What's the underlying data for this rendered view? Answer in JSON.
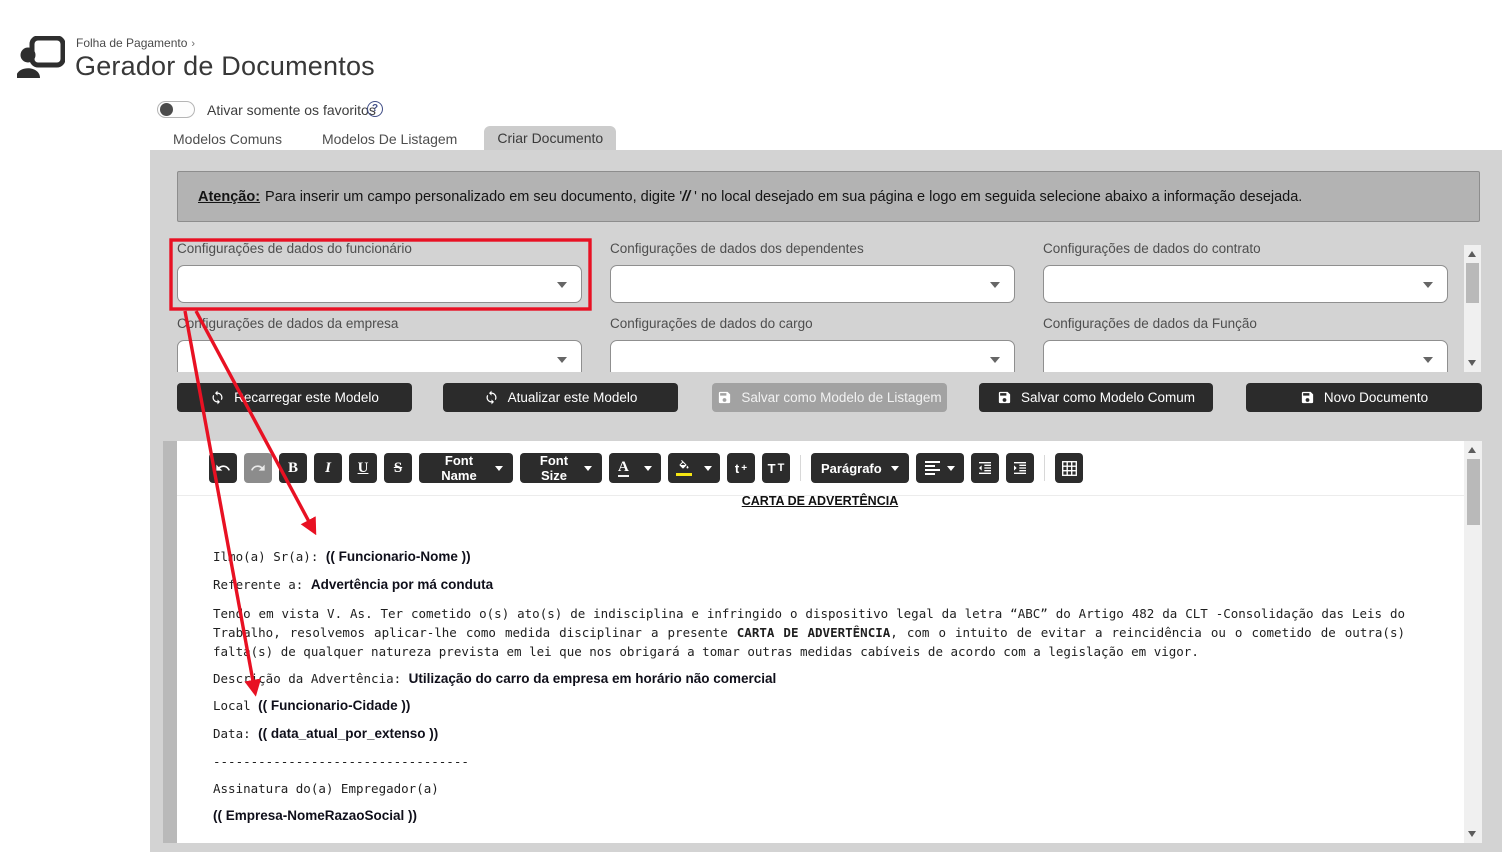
{
  "header": {
    "breadcrumb": "Folha de Pagamento",
    "breadcrumb_caret": "›",
    "title": "Gerador de Documentos"
  },
  "favorites": {
    "label": "Ativar somente os favoritos",
    "help_glyph": "?",
    "enabled": false
  },
  "tabs": [
    {
      "label": "Modelos Comuns",
      "active": false
    },
    {
      "label": "Modelos De Listagem",
      "active": false
    },
    {
      "label": "Criar Documento",
      "active": true
    }
  ],
  "notice": {
    "strong": "Atenção:",
    "pre": "Para inserir um campo personalizado em seu documento, digite '",
    "slashes": "//",
    "post": " ' no local desejado em sua página e logo em seguida selecione abaixo a informação desejada."
  },
  "fields": [
    {
      "label": "Configurações de dados do funcionário",
      "value": "",
      "highlighted": true
    },
    {
      "label": "Configurações de dados dos dependentes",
      "value": "",
      "highlighted": false
    },
    {
      "label": "Configurações de dados do contrato",
      "value": "",
      "highlighted": false
    },
    {
      "label": "Configurações de dados da empresa",
      "value": "",
      "highlighted": false
    },
    {
      "label": "Configurações de dados do cargo",
      "value": "",
      "highlighted": false
    },
    {
      "label": "Configurações de dados da Função",
      "value": "",
      "highlighted": false
    }
  ],
  "actions": [
    {
      "label": "Recarregar este Modelo",
      "icon": "refresh-icon",
      "disabled": false
    },
    {
      "label": "Atualizar este Modelo",
      "icon": "refresh-icon",
      "disabled": false
    },
    {
      "label": "Salvar como Modelo de Listagem",
      "icon": "save-icon",
      "disabled": true
    },
    {
      "label": "Salvar como Modelo Comum",
      "icon": "save-icon",
      "disabled": false
    },
    {
      "label": "Novo Documento",
      "icon": "save-icon",
      "disabled": false
    }
  ],
  "toolbar": {
    "bold": "B",
    "italic": "I",
    "underline": "U",
    "strike": "S",
    "font_name": "Font Name",
    "font_size": "Font Size",
    "font_color": "A",
    "sub_main": "t",
    "sub_plus": "+",
    "case_main": "T",
    "case_small": "T",
    "paragraph": "Parágrafo"
  },
  "document": {
    "title": "CARTA DE ADVERTÊNCIA",
    "salutation_plain": "Ilmo(a) Sr(a):",
    "salutation_token": "(( Funcionario-Nome ))",
    "subject_plain": "Referente a:",
    "subject_bold": "Advertência por má conduta",
    "body_pre": "Tendo em vista V. As. Ter cometido o(s) ato(s) de indisciplina e infringido o dispositivo legal da letra “ABC” do Artigo 482 da CLT  -Consolidação das Leis do Trabalho, resolvemos aplicar-lhe como medida disciplinar a presente ",
    "body_bold": "CARTA DE ADVERTÊNCIA",
    "body_post": ", com o intuito de evitar a reincidência ou o cometido de outra(s) falta(s) de qualquer natureza prevista em lei que nos obrigará a tomar outras medidas cabíveis de acordo com a legislação em vigor.",
    "descr_plain": "Descrição da Advertência: ",
    "descr_bold": "Utilização do carro da empresa em horário não comercial",
    "local_plain": "Local ",
    "local_token": "(( Funcionario-Cidade ))",
    "date_plain": "Data:",
    "date_token": "(( data_atual_por_extenso ))",
    "separator": "----------------------------------",
    "signature": "Assinatura do(a) Empregador(a)",
    "company_token": "(( Empresa-NomeRazaoSocial ))"
  },
  "annotation": {
    "color": "#e81123"
  }
}
